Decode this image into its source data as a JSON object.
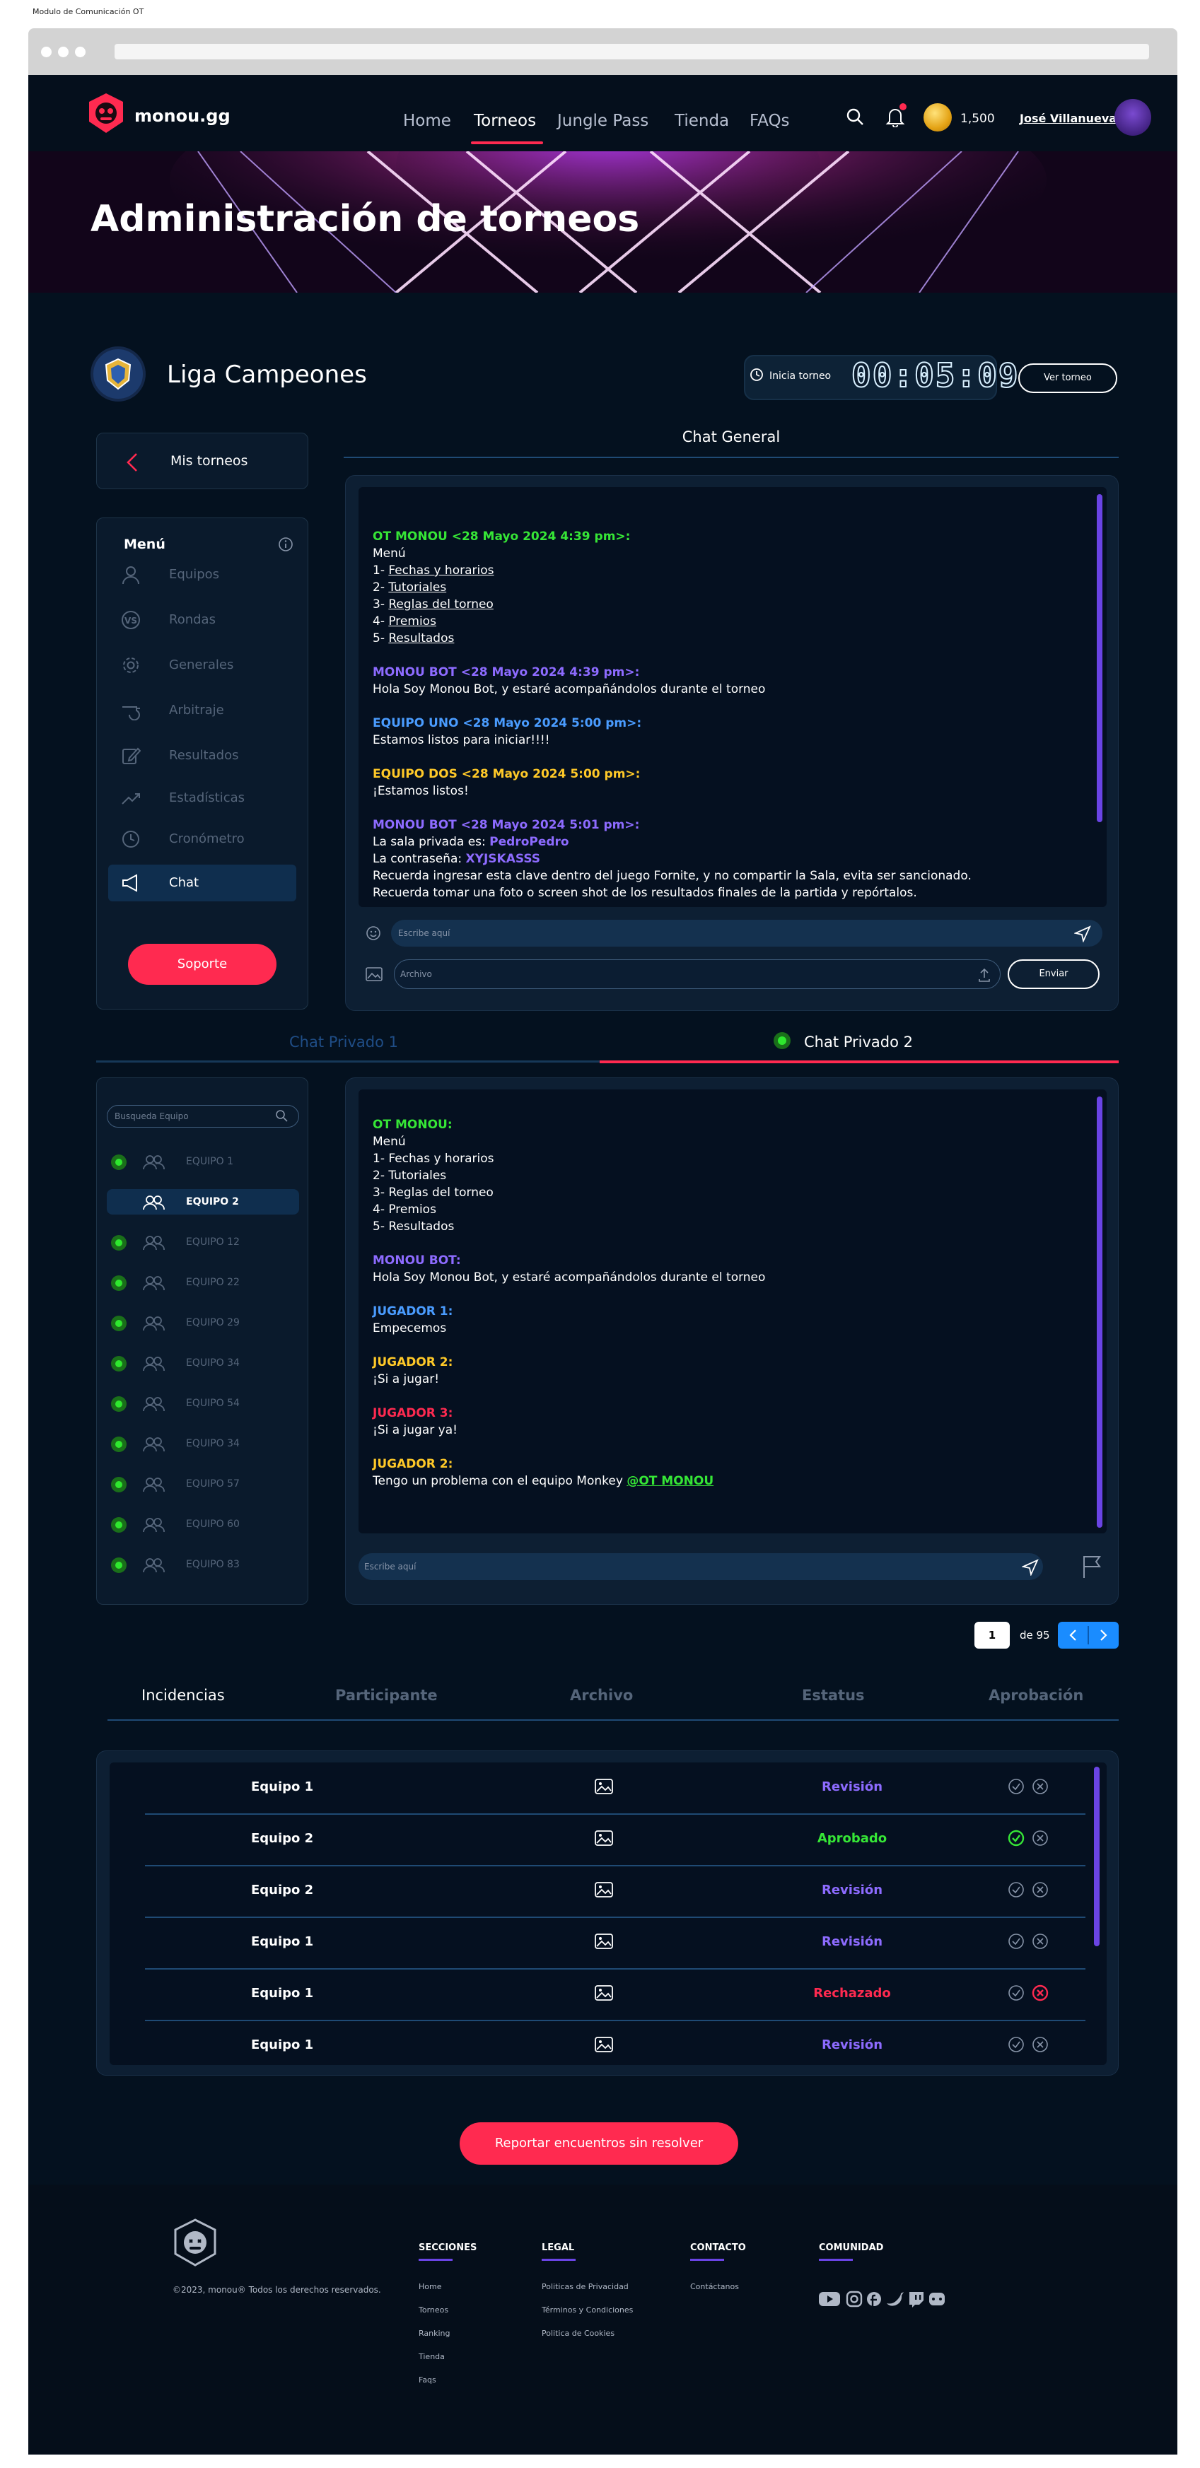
{
  "caption": "Modulo de Comunicación OT",
  "nav": {
    "brand": "monou.gg",
    "items": [
      "Home",
      "Torneos",
      "Jungle Pass",
      "Tienda",
      "FAQs"
    ],
    "active": "Torneos",
    "coins": "1,500",
    "username": "José Villanueva"
  },
  "hero": {
    "title": "Administración de torneos"
  },
  "tournament": {
    "name": "Liga Campeones",
    "timer_label": "Inicia torneo",
    "timer_value": "00:05:09",
    "view_button": "Ver torneo"
  },
  "sidebar": {
    "back_label": "Mis torneos",
    "menu_title": "Menú",
    "items": [
      "Equipos",
      "Rondas",
      "Generales",
      "Arbitraje",
      "Resultados",
      "Estadísticas",
      "Cronómetro",
      "Chat"
    ],
    "active": "Chat",
    "support_button": "Soporte"
  },
  "general_chat": {
    "title": "Chat General",
    "messages": [
      {
        "who": "OT MONOU <28 Mayo 2024 4:39 pm>:",
        "color": "#36e636",
        "lines": [
          {
            "parts": [
              {
                "t": "Menú"
              }
            ]
          },
          {
            "parts": [
              {
                "t": "1- "
              },
              {
                "t": "Fechas y horarios",
                "u": true
              }
            ]
          },
          {
            "parts": [
              {
                "t": "2- "
              },
              {
                "t": "Tutoriales",
                "u": true
              }
            ]
          },
          {
            "parts": [
              {
                "t": "3- "
              },
              {
                "t": "Reglas del torneo",
                "u": true
              }
            ]
          },
          {
            "parts": [
              {
                "t": "4- "
              },
              {
                "t": "Premios",
                "u": true
              }
            ]
          },
          {
            "parts": [
              {
                "t": "5- "
              },
              {
                "t": "Resultados",
                "u": true
              }
            ]
          }
        ]
      },
      {
        "who": "MONOU BOT <28 Mayo 2024 4:39 pm>:",
        "color": "#8d6bff",
        "lines": [
          {
            "parts": [
              {
                "t": "Hola Soy Monou Bot, y estaré acompañándolos durante el torneo"
              }
            ]
          }
        ]
      },
      {
        "who": "EQUIPO UNO <28 Mayo 2024 5:00 pm>:",
        "color": "#4a9cff",
        "lines": [
          {
            "parts": [
              {
                "t": "Estamos listos para iniciar!!!!"
              }
            ]
          }
        ]
      },
      {
        "who": "EQUIPO DOS <28 Mayo 2024 5:00 pm>:",
        "color": "#ffc928",
        "lines": [
          {
            "parts": [
              {
                "t": "¡Estamos listos!"
              }
            ]
          }
        ]
      },
      {
        "who": "MONOU BOT <28 Mayo 2024 5:01 pm>:",
        "color": "#8d6bff",
        "lines": [
          {
            "parts": [
              {
                "t": "La sala privada es: "
              },
              {
                "t": "PedroPedro",
                "c": "#8d6bff",
                "b": true
              }
            ]
          },
          {
            "parts": [
              {
                "t": "La contraseña:  "
              },
              {
                "t": "XYJSKASSS",
                "c": "#8d6bff",
                "b": true
              }
            ]
          },
          {
            "parts": [
              {
                "t": "Recuerda ingresar esta clave dentro del juego Fornite, y no compartir la Sala, evita ser sancionado."
              }
            ]
          },
          {
            "parts": [
              {
                "t": "Recuerda tomar una foto o screen shot de los resultados finales de la partida y repórtalos."
              }
            ]
          }
        ]
      }
    ],
    "input_placeholder": "Escribe aquí",
    "file_placeholder": "Archivo",
    "send_button": "Enviar"
  },
  "private_tabs": [
    "Chat Privado 1",
    "Chat  Privado 2"
  ],
  "team_search_placeholder": "Busqueda Equipo",
  "teams": [
    {
      "name": "EQUIPO 1",
      "online": true
    },
    {
      "name": "EQUIPO 2",
      "online": false,
      "active": true
    },
    {
      "name": "EQUIPO 12",
      "online": true
    },
    {
      "name": "EQUIPO 22",
      "online": true
    },
    {
      "name": "EQUIPO 29",
      "online": true
    },
    {
      "name": "EQUIPO 34",
      "online": true
    },
    {
      "name": "EQUIPO 54",
      "online": true
    },
    {
      "name": "EQUIPO 34",
      "online": true
    },
    {
      "name": "EQUIPO 57",
      "online": true
    },
    {
      "name": "EQUIPO 60",
      "online": true
    },
    {
      "name": "EQUIPO 83",
      "online": true
    }
  ],
  "private_chat": {
    "messages": [
      {
        "who": "OT MONOU:",
        "color": "#36e636",
        "lines": [
          {
            "parts": [
              {
                "t": "Menú"
              }
            ]
          },
          {
            "parts": [
              {
                "t": "1- Fechas y horarios"
              }
            ]
          },
          {
            "parts": [
              {
                "t": "2- Tutoriales"
              }
            ]
          },
          {
            "parts": [
              {
                "t": "3- Reglas del torneo"
              }
            ]
          },
          {
            "parts": [
              {
                "t": "4- Premios"
              }
            ]
          },
          {
            "parts": [
              {
                "t": "5- Resultados"
              }
            ]
          }
        ]
      },
      {
        "who": "MONOU BOT:",
        "color": "#8d6bff",
        "lines": [
          {
            "parts": [
              {
                "t": "Hola Soy Monou Bot, y estaré acompañándolos durante el torneo"
              }
            ]
          }
        ]
      },
      {
        "who": "JUGADOR 1:",
        "color": "#4a9cff",
        "lines": [
          {
            "parts": [
              {
                "t": "Empecemos"
              }
            ]
          }
        ]
      },
      {
        "who": "JUGADOR 2:",
        "color": "#ffc928",
        "lines": [
          {
            "parts": [
              {
                "t": "¡Si a jugar!"
              }
            ]
          }
        ]
      },
      {
        "who": "JUGADOR 3:",
        "color": "#ff2a50",
        "lines": [
          {
            "parts": [
              {
                "t": "¡Si a jugar ya!"
              }
            ]
          }
        ]
      },
      {
        "who": "JUGADOR 2:",
        "color": "#ffc928",
        "lines": [
          {
            "parts": [
              {
                "t": "Tengo un problema con el equipo Monkey "
              },
              {
                "t": "@OT MONOU",
                "c": "#36e636",
                "b": true,
                "u": true
              }
            ]
          }
        ]
      }
    ],
    "input_placeholder": "Escribe aquí"
  },
  "pagination": {
    "current": "1",
    "of_label": "de 95"
  },
  "incidents": {
    "headers": [
      "Incidencias",
      "Participante",
      "Archivo",
      "Estatus",
      "Aprobación"
    ],
    "rows": [
      {
        "team": "Equipo 1",
        "status": "Revisión",
        "status_color": "#8d6bff"
      },
      {
        "team": "Equipo 2",
        "status": "Aprobado",
        "status_color": "#36e636",
        "approved": true
      },
      {
        "team": "Equipo 2",
        "status": "Revisión",
        "status_color": "#8d6bff"
      },
      {
        "team": "Equipo 1",
        "status": "Revisión",
        "status_color": "#8d6bff"
      },
      {
        "team": "Equipo 1",
        "status": "Rechazado",
        "status_color": "#ff2a50",
        "rejected": true
      },
      {
        "team": "Equipo 1",
        "status": "Revisión",
        "status_color": "#8d6bff"
      }
    ],
    "report_button": "Reportar encuentros sin resolver"
  },
  "footer": {
    "copyright": "©2023, monou® Todos los derechos reservados.",
    "columns": [
      {
        "title": "SECCIONES",
        "links": [
          "Home",
          "Torneos",
          "Ranking",
          "Tienda",
          "Faqs"
        ]
      },
      {
        "title": "LEGAL",
        "links": [
          "Politicas de Privacidad",
          "Términos y Condiciones",
          "Politica de Cookies"
        ]
      },
      {
        "title": "CONTACTO",
        "links": [
          "Contáctanos"
        ]
      },
      {
        "title": "COMUNIDAD",
        "links": []
      }
    ],
    "social_icons": [
      "youtube-icon",
      "instagram-icon",
      "facebook-icon",
      "twitter-icon",
      "twitch-icon",
      "discord-icon"
    ]
  },
  "colors": {
    "accent": "#ff2a50",
    "purple": "#6a44e4",
    "background": "#04111f",
    "panel": "#0d1f33"
  }
}
